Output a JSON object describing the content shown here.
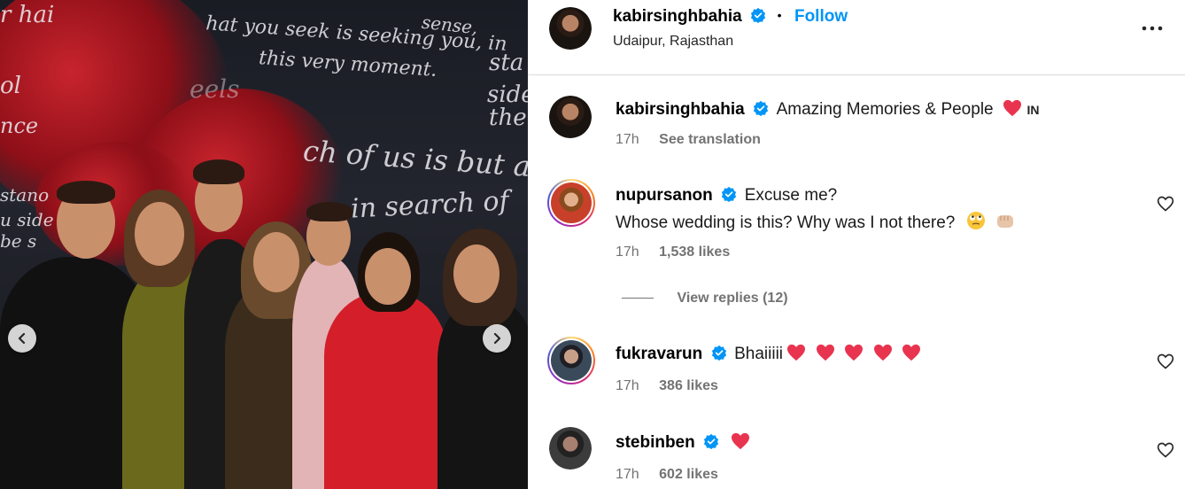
{
  "post_image": {
    "wall_text": [
      "r hai",
      "hat you seek is seeking you, in",
      "this very moment.",
      "sense,",
      "sta",
      "side",
      "the",
      "ch of us is but a",
      "in search of",
      "eels",
      "ol",
      "nce",
      "stano",
      "u side",
      "be s"
    ],
    "prev_icon": "chevron-left-icon",
    "next_icon": "chevron-right-icon"
  },
  "header": {
    "username": "kabirsinghbahia",
    "separator": "•",
    "follow_label": "Follow",
    "location": "Udaipur, Rajasthan",
    "more_icon": "more-options-icon"
  },
  "caption": {
    "username": "kabirsinghbahia",
    "text": "Amazing Memories & People",
    "flag": "IN",
    "time": "17h",
    "see_translation": "See translation"
  },
  "comments": [
    {
      "username": "nupursanon",
      "line1": "Excuse me?",
      "line2": "Whose wedding is this? Why was I not there?",
      "time": "17h",
      "likes": "1,538 likes",
      "view_replies": "View replies (12)"
    },
    {
      "username": "fukravarun",
      "text": "Bhaiiiii",
      "time": "17h",
      "likes": "386 likes"
    },
    {
      "username": "stebinben",
      "time": "17h",
      "likes": "602 likes"
    }
  ],
  "colors": {
    "accent": "#0095f6",
    "verified": "#0095f6",
    "heart": "#e8344f",
    "muted": "#737373",
    "divider": "#dbdbdb"
  }
}
